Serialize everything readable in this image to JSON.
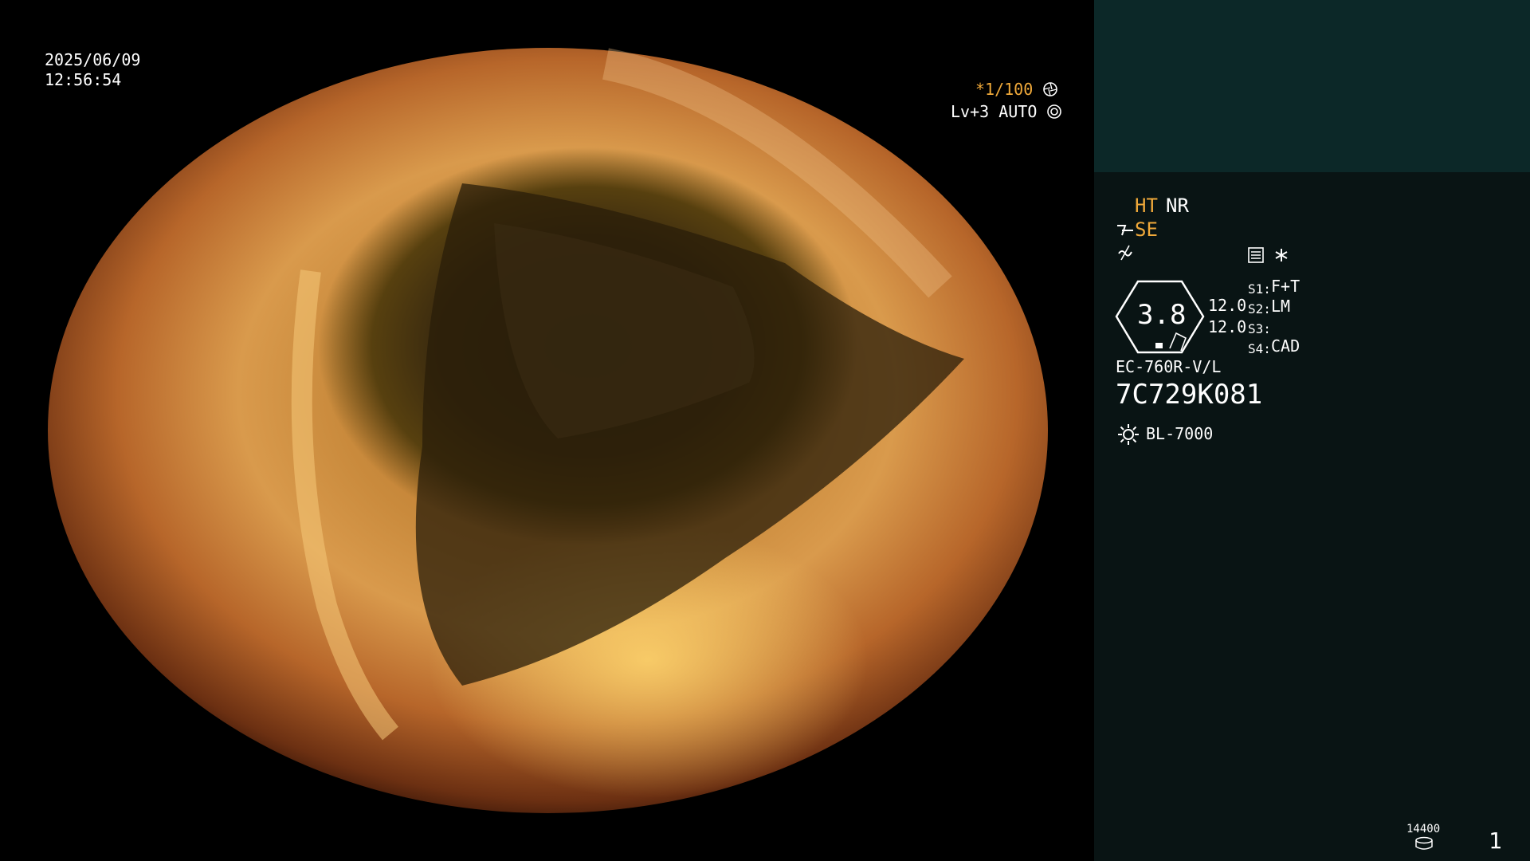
{
  "overlay": {
    "date": "2025/06/09",
    "time": "12:56:54",
    "shutter": "*1/100",
    "level": "Lv+3 AUTO"
  },
  "panel": {
    "ht": "HT",
    "nr": "NR",
    "se": "SE",
    "hex_value": "3.8",
    "value_a": "12.0",
    "value_b": "12.0",
    "slots": [
      {
        "label": "S1:",
        "value": "F+T"
      },
      {
        "label": "S2:",
        "value": "LM"
      },
      {
        "label": "S3:",
        "value": ""
      },
      {
        "label": "S4:",
        "value": "CAD"
      }
    ],
    "model": "EC-760R-V/L",
    "serial": "7C729K081",
    "light_source": "BL-7000",
    "counter": "14400",
    "page_number": "1"
  },
  "icons": {
    "shutter_icon": "aperture-icon",
    "level_icon": "gear-circle-icon",
    "scope_icon": "scope-tilt-icon",
    "wave_icon": "wave-icon",
    "settings_icon": "list-settings-icon",
    "asterisk_icon": "asterisk-icon",
    "light_icon": "sun-icon",
    "storage_icon": "database-icon"
  },
  "colors": {
    "accent": "#f0a93a",
    "panel_bg": "#091414",
    "panel_header_bg": "#0c2828"
  }
}
